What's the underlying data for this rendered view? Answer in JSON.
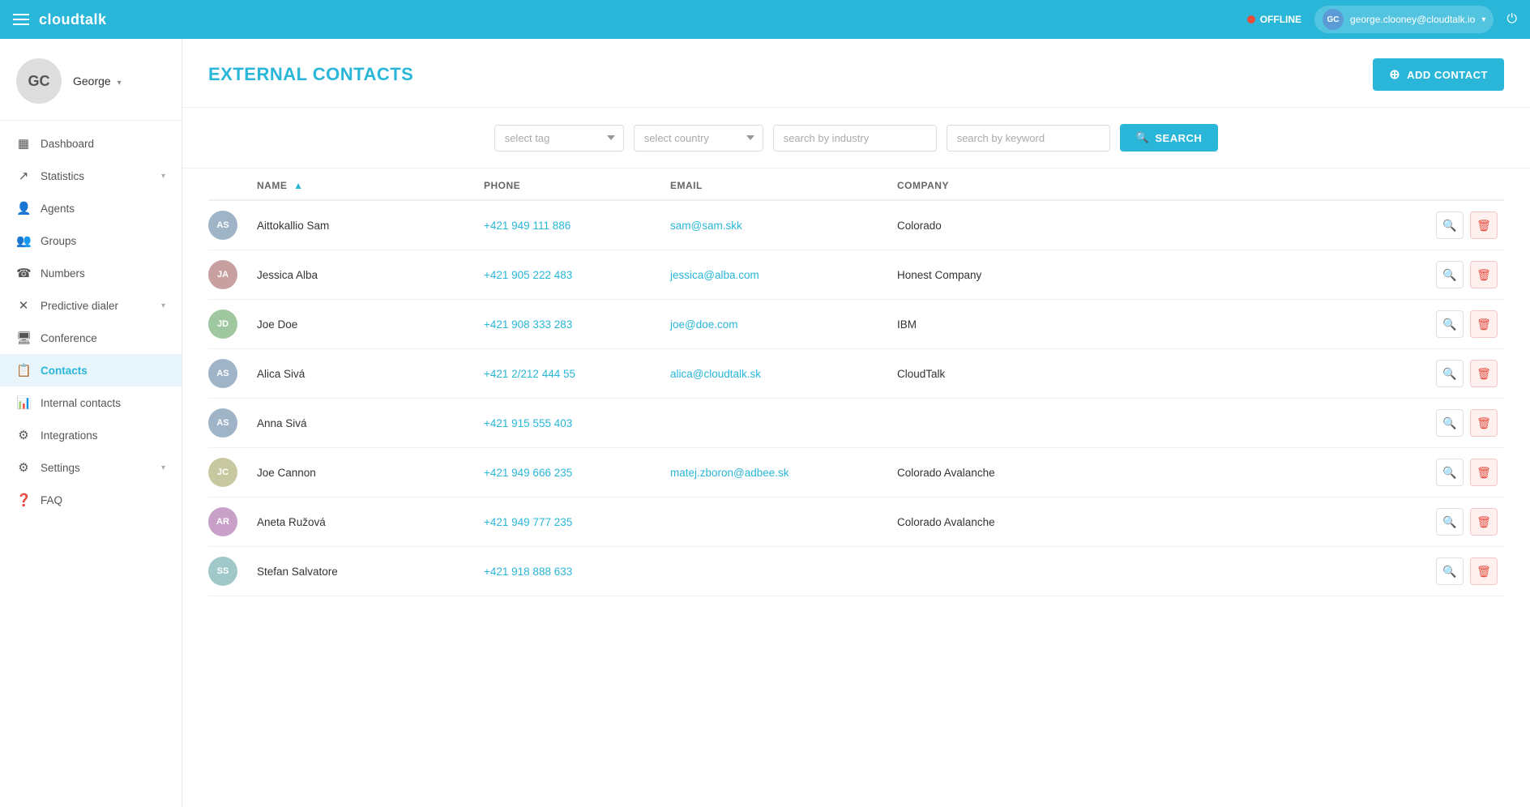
{
  "topbar": {
    "logo": "cloudtalk",
    "status": "OFFLINE",
    "user_email": "george.clooney@cloudtalk.io",
    "user_initials": "GC"
  },
  "sidebar": {
    "profile_initials": "GC",
    "profile_name": "George",
    "nav_items": [
      {
        "id": "dashboard",
        "label": "Dashboard",
        "icon": "▦"
      },
      {
        "id": "statistics",
        "label": "Statistics",
        "icon": "↗",
        "has_arrow": true
      },
      {
        "id": "agents",
        "label": "Agents",
        "icon": "👤"
      },
      {
        "id": "groups",
        "label": "Groups",
        "icon": "👥"
      },
      {
        "id": "numbers",
        "label": "Numbers",
        "icon": "📞"
      },
      {
        "id": "predictive-dialer",
        "label": "Predictive dialer",
        "icon": "✕",
        "has_arrow": true
      },
      {
        "id": "conference",
        "label": "Conference",
        "icon": "🖥"
      },
      {
        "id": "contacts",
        "label": "Contacts",
        "icon": "📋",
        "active": true
      },
      {
        "id": "internal-contacts",
        "label": "Internal contacts",
        "icon": "📊"
      },
      {
        "id": "integrations",
        "label": "Integrations",
        "icon": "⚙"
      },
      {
        "id": "settings",
        "label": "Settings",
        "icon": "⚙",
        "has_arrow": true
      },
      {
        "id": "faq",
        "label": "FAQ",
        "icon": "❓"
      }
    ]
  },
  "page": {
    "title": "EXTERNAL CONTACTS",
    "add_contact_label": "ADD CONTACT"
  },
  "filters": {
    "tag_placeholder": "select tag",
    "country_placeholder": "select country",
    "industry_placeholder": "search by industry",
    "keyword_placeholder": "search by keyword",
    "search_label": "SEARCH"
  },
  "table": {
    "columns": [
      "",
      "NAME",
      "PHONE",
      "EMAIL",
      "COMPANY",
      ""
    ],
    "rows": [
      {
        "initials": "AS",
        "name": "Aittokallio Sam",
        "phone": "+421 949 111 886",
        "email": "sam@sam.skk",
        "company": "Colorado",
        "avatar_color": "#a0b4c8"
      },
      {
        "initials": "JA",
        "name": "Jessica Alba",
        "phone": "+421 905 222 483",
        "email": "jessica@alba.com",
        "company": "Honest Company",
        "avatar_color": "#c8a0a0"
      },
      {
        "initials": "JD",
        "name": "Joe Doe",
        "phone": "+421 908 333 283",
        "email": "joe@doe.com",
        "company": "IBM",
        "avatar_color": "#a0c8a0"
      },
      {
        "initials": "AS",
        "name": "Alica Sivá",
        "phone": "+421 2/212 444 55",
        "email": "alica@cloudtalk.sk",
        "company": "CloudTalk",
        "avatar_color": "#a0b4c8"
      },
      {
        "initials": "AS",
        "name": "Anna Sivá",
        "phone": "+421 915 555 403",
        "email": "",
        "company": "",
        "avatar_color": "#a0b4c8"
      },
      {
        "initials": "JC",
        "name": "Joe Cannon",
        "phone": "+421 949 666 235",
        "email": "matej.zboron@adbee.sk",
        "company": "Colorado Avalanche",
        "avatar_color": "#c8c8a0"
      },
      {
        "initials": "AR",
        "name": "Aneta Ružová",
        "phone": "+421 949 777 235",
        "email": "",
        "company": "Colorado Avalanche",
        "avatar_color": "#c8a0c8"
      },
      {
        "initials": "SS",
        "name": "Stefan Salvatore",
        "phone": "+421 918 888 633",
        "email": "",
        "company": "",
        "avatar_color": "#a0c8c8"
      }
    ]
  }
}
